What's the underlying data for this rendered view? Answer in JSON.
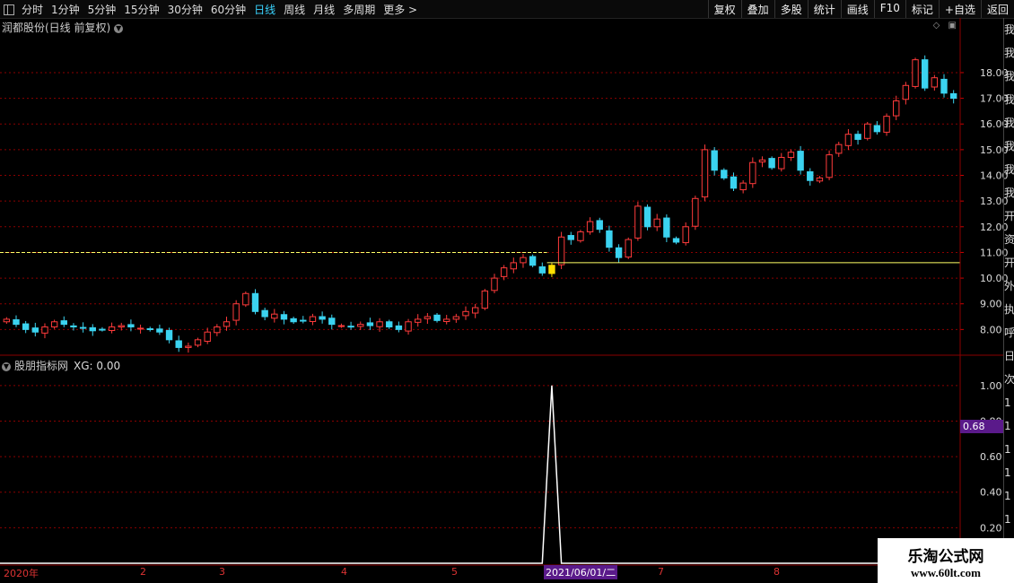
{
  "toolbar": {
    "periods": [
      "分时",
      "1分钟",
      "5分钟",
      "15分钟",
      "30分钟",
      "60分钟",
      "日线",
      "周线",
      "月线",
      "多周期",
      "更多 >"
    ],
    "active_period": "日线",
    "buttons": [
      "复权",
      "叠加",
      "多股",
      "统计",
      "画线",
      "F10",
      "标记",
      "+自选",
      "返回"
    ]
  },
  "main_panel": {
    "title": "润都股份(日线 前复权)"
  },
  "indicator_panel": {
    "title": "股朋指标网",
    "xg_label": "XG: 0.00",
    "cursor_value": "0.68"
  },
  "x_axis": {
    "ticks": [
      "2020年",
      "2",
      "3",
      "4",
      "5",
      "2021/06/01/二",
      "7",
      "8"
    ],
    "cursor_label": "2021/06/01/二"
  },
  "sidebar_chars": [
    "我",
    "我",
    "我",
    "我",
    "我",
    "我",
    "我",
    "我",
    "开",
    "资",
    "开",
    "外",
    "执",
    "呼",
    "日",
    "次",
    "1",
    "1",
    "1",
    "1",
    "1",
    "1",
    "1",
    "1"
  ],
  "watermark": {
    "name": "乐淘公式网",
    "url": "www.60lt.com"
  },
  "colors": {
    "up": "#ff3b3b",
    "down": "#3bd3f0",
    "signal": "#ffe000",
    "support": "#ffff66",
    "grid": "#8b0000"
  },
  "chart_data": [
    {
      "type": "candlestick",
      "title": "润都股份(日线 前复权)",
      "y_ticks": [
        8.0,
        9.0,
        10.0,
        11.0,
        12.0,
        13.0,
        14.0,
        15.0,
        16.0,
        17.0,
        18.0
      ],
      "ylim": [
        7.0,
        19.5
      ],
      "support_lines": [
        11.0,
        10.6
      ],
      "closes": [
        8.4,
        8.2,
        8.0,
        7.9,
        8.1,
        8.3,
        8.2,
        8.1,
        8.05,
        7.95,
        8.0,
        8.1,
        8.15,
        8.1,
        8.05,
        8.0,
        7.9,
        7.6,
        7.3,
        7.35,
        7.6,
        7.9,
        8.1,
        8.3,
        9.0,
        9.4,
        8.7,
        8.5,
        8.6,
        8.4,
        8.3,
        8.35,
        8.5,
        8.4,
        8.2,
        8.15,
        8.1,
        8.2,
        8.15,
        8.3,
        8.1,
        8.0,
        8.3,
        8.4,
        8.5,
        8.35,
        8.4,
        8.5,
        8.7,
        8.85,
        9.5,
        10.0,
        10.4,
        10.6,
        10.8,
        10.5,
        10.2,
        10.5,
        11.6,
        11.5,
        11.8,
        12.2,
        11.9,
        11.2,
        10.8,
        11.5,
        12.8,
        12.0,
        12.3,
        11.6,
        11.4,
        12.0,
        13.1,
        15.0,
        14.2,
        13.9,
        13.5,
        13.7,
        14.5,
        14.6,
        14.3,
        14.7,
        14.9,
        14.2,
        13.8,
        13.9,
        14.8,
        15.2,
        15.6,
        15.4,
        16.0,
        15.7,
        16.3,
        16.9,
        17.5,
        18.5,
        17.4,
        17.8,
        17.2,
        17.0
      ]
    },
    {
      "type": "line",
      "series": [
        {
          "name": "XG",
          "signal_index": 57,
          "signal_value": 1.0
        }
      ],
      "y_ticks": [
        0.2,
        0.4,
        0.6,
        0.68,
        0.8,
        1.0
      ],
      "ylim": [
        0,
        1.1
      ]
    }
  ]
}
